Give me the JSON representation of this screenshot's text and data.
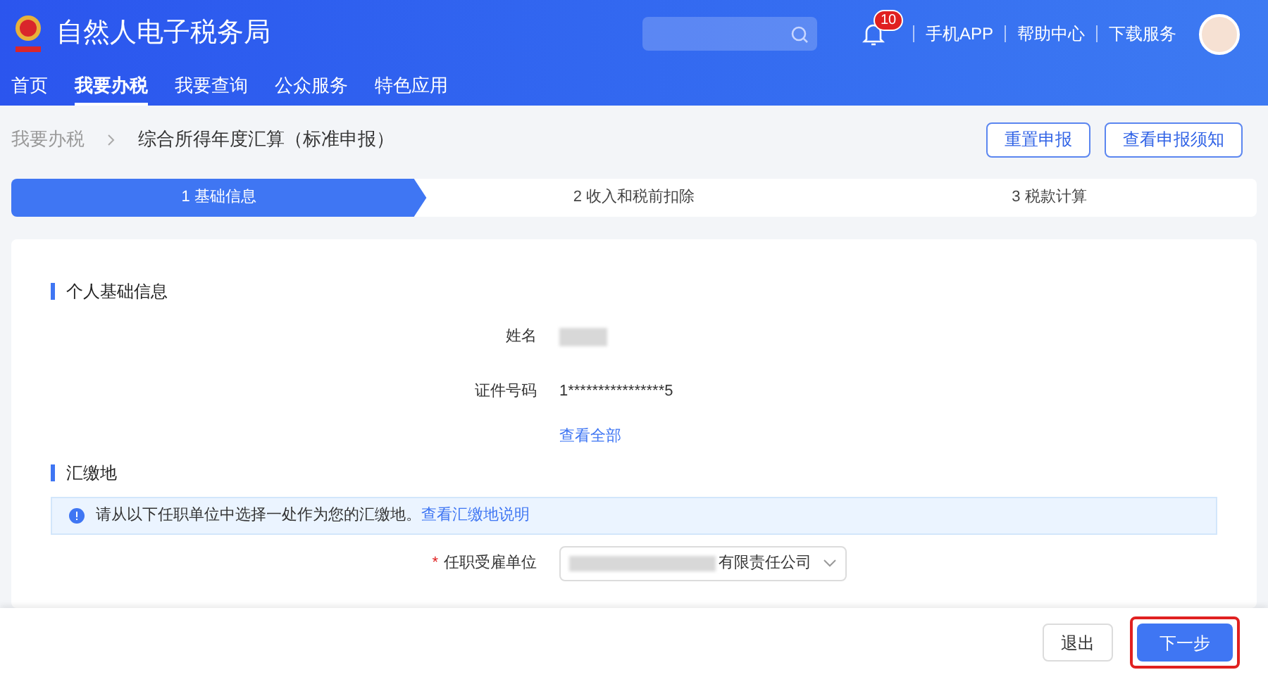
{
  "header": {
    "title": "自然人电子税务局",
    "notification_count": "10",
    "links": [
      "手机APP",
      "帮助中心",
      "下载服务"
    ]
  },
  "nav": [
    {
      "label": "首页",
      "selected": false
    },
    {
      "label": "我要办税",
      "selected": true
    },
    {
      "label": "我要查询",
      "selected": false
    },
    {
      "label": "公众服务",
      "selected": false
    },
    {
      "label": "特色应用",
      "selected": false
    }
  ],
  "breadcrumb": [
    "我要办税",
    "综合所得年度汇算（标准申报）"
  ],
  "actions": [
    "重置申报",
    "查看申报须知"
  ],
  "steps": [
    {
      "label": "1 基础信息",
      "selected": true
    },
    {
      "label": "2 收入和税前扣除",
      "selected": false
    },
    {
      "label": "3 税款计算",
      "selected": false
    }
  ],
  "basic_info": {
    "title": "个人基础信息",
    "fields": [
      {
        "label": "姓名",
        "redacted": true
      },
      {
        "label": "证件号码",
        "value": "1****************5",
        "redacted": false
      }
    ],
    "view_all": "查看全部"
  },
  "payment_place": {
    "title": "汇缴地",
    "notice": "请从以下任职单位中选择一处作为您的汇缴地。",
    "notice_link": "查看汇缴地说明",
    "employer_label": "任职受雇单位",
    "required_mark": "*",
    "employer_value": "有限责任公司"
  },
  "footer": {
    "exit": "退出",
    "next": "下一步",
    "next_highlighted": true
  }
}
